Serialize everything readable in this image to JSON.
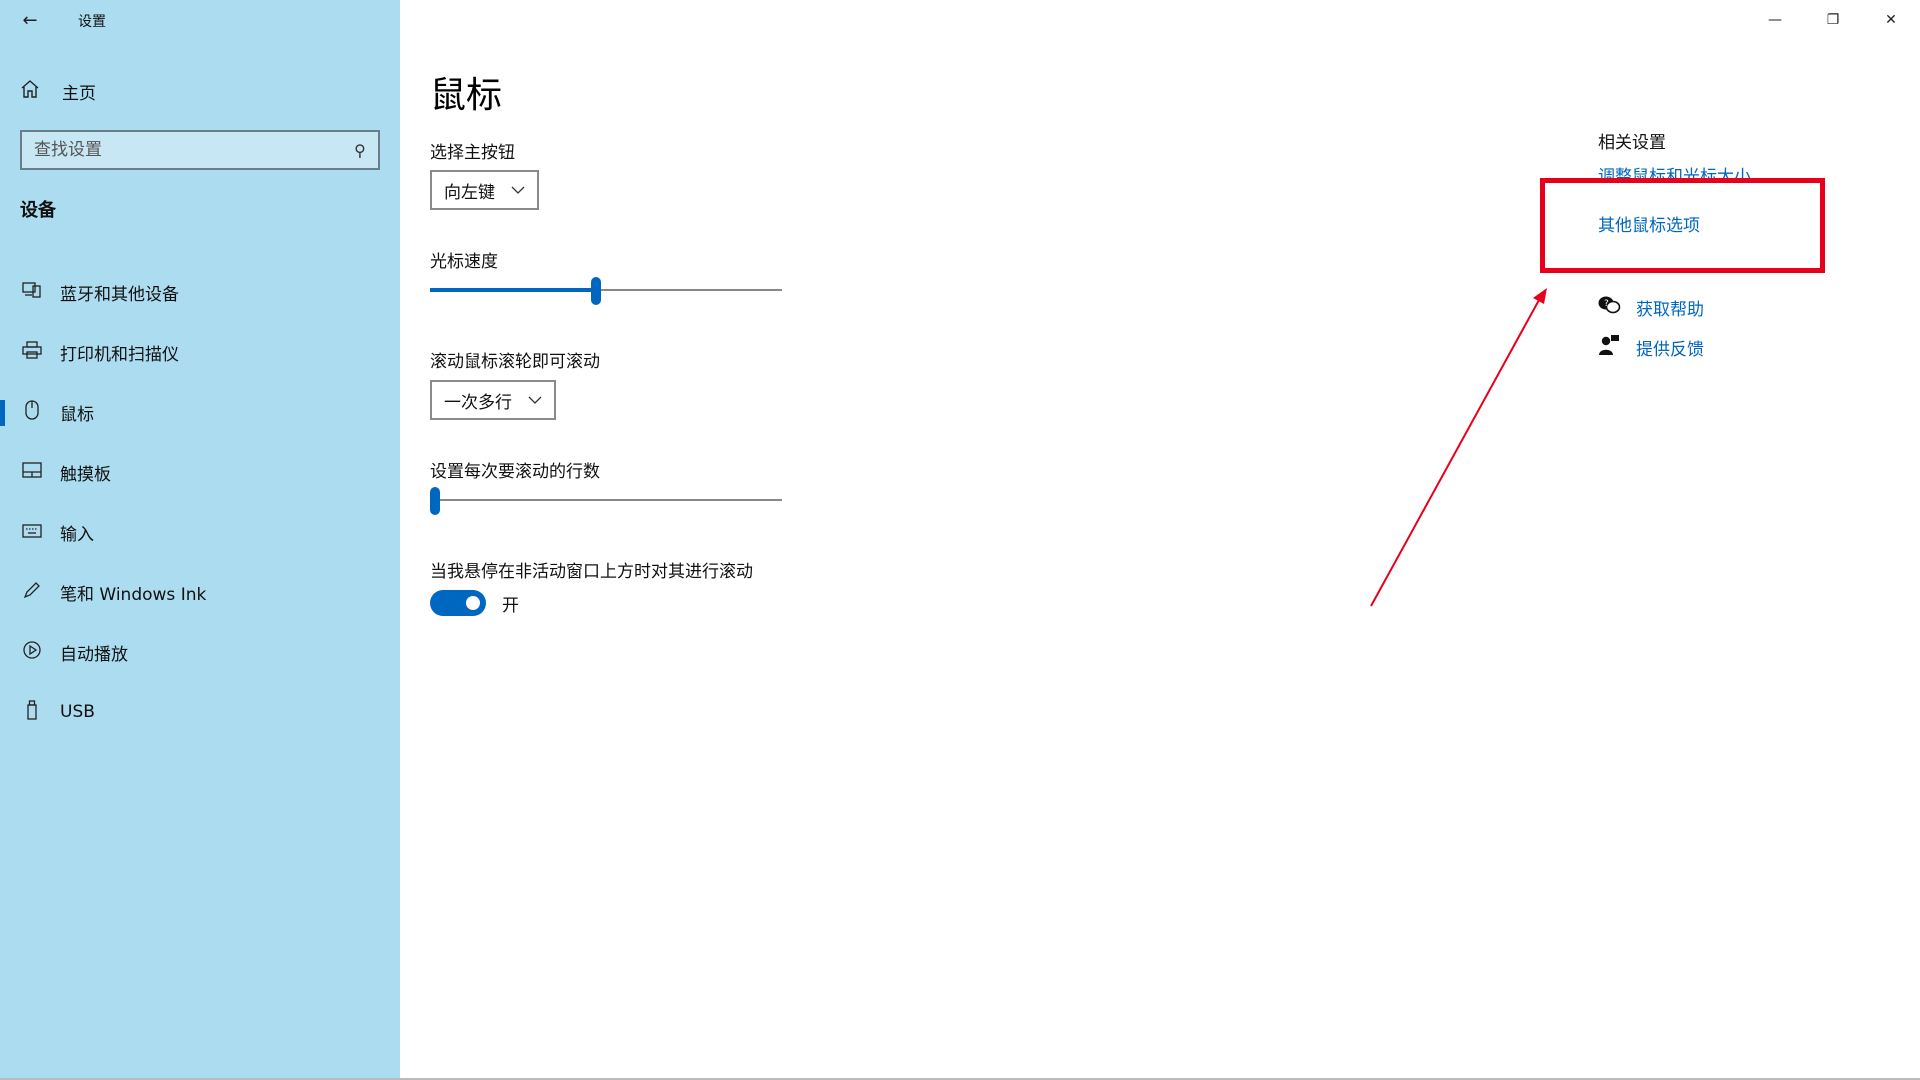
{
  "titlebar": {
    "back_label": "←",
    "app_title": "设置",
    "minimize": "—",
    "restore": "❐",
    "close": "✕"
  },
  "sidebar": {
    "home_label": "主页",
    "search_placeholder": "查找设置",
    "section_title": "设备",
    "items": [
      {
        "label": "蓝牙和其他设备",
        "icon": "devices-icon"
      },
      {
        "label": "打印机和扫描仪",
        "icon": "printer-icon"
      },
      {
        "label": "鼠标",
        "icon": "mouse-icon",
        "selected": true
      },
      {
        "label": "触摸板",
        "icon": "touchpad-icon"
      },
      {
        "label": "输入",
        "icon": "keyboard-icon"
      },
      {
        "label": "笔和 Windows Ink",
        "icon": "pen-icon"
      },
      {
        "label": "自动播放",
        "icon": "autoplay-icon"
      },
      {
        "label": "USB",
        "icon": "usb-icon"
      }
    ]
  },
  "main": {
    "page_title": "鼠标",
    "primary_button_label": "选择主按钮",
    "primary_button_value": "向左键",
    "cursor_speed_label": "光标速度",
    "cursor_speed_level": 0.47,
    "scroll_label": "滚动鼠标滚轮即可滚动",
    "scroll_value": "一次多行",
    "lines_label": "设置每次要滚动的行数",
    "lines_level": 0.0,
    "inactive_scroll_label": "当我悬停在非活动窗口上方时对其进行滚动",
    "inactive_scroll_state": "开"
  },
  "related": {
    "heading": "相关设置",
    "link_adjust": "调整鼠标和光标大小",
    "link_other": "其他鼠标选项",
    "get_help": "获取帮助",
    "feedback": "提供反馈"
  },
  "colors": {
    "sidebar_bg": "#abdcef",
    "accent": "#0067c0",
    "annotation_red": "#e8001a"
  }
}
